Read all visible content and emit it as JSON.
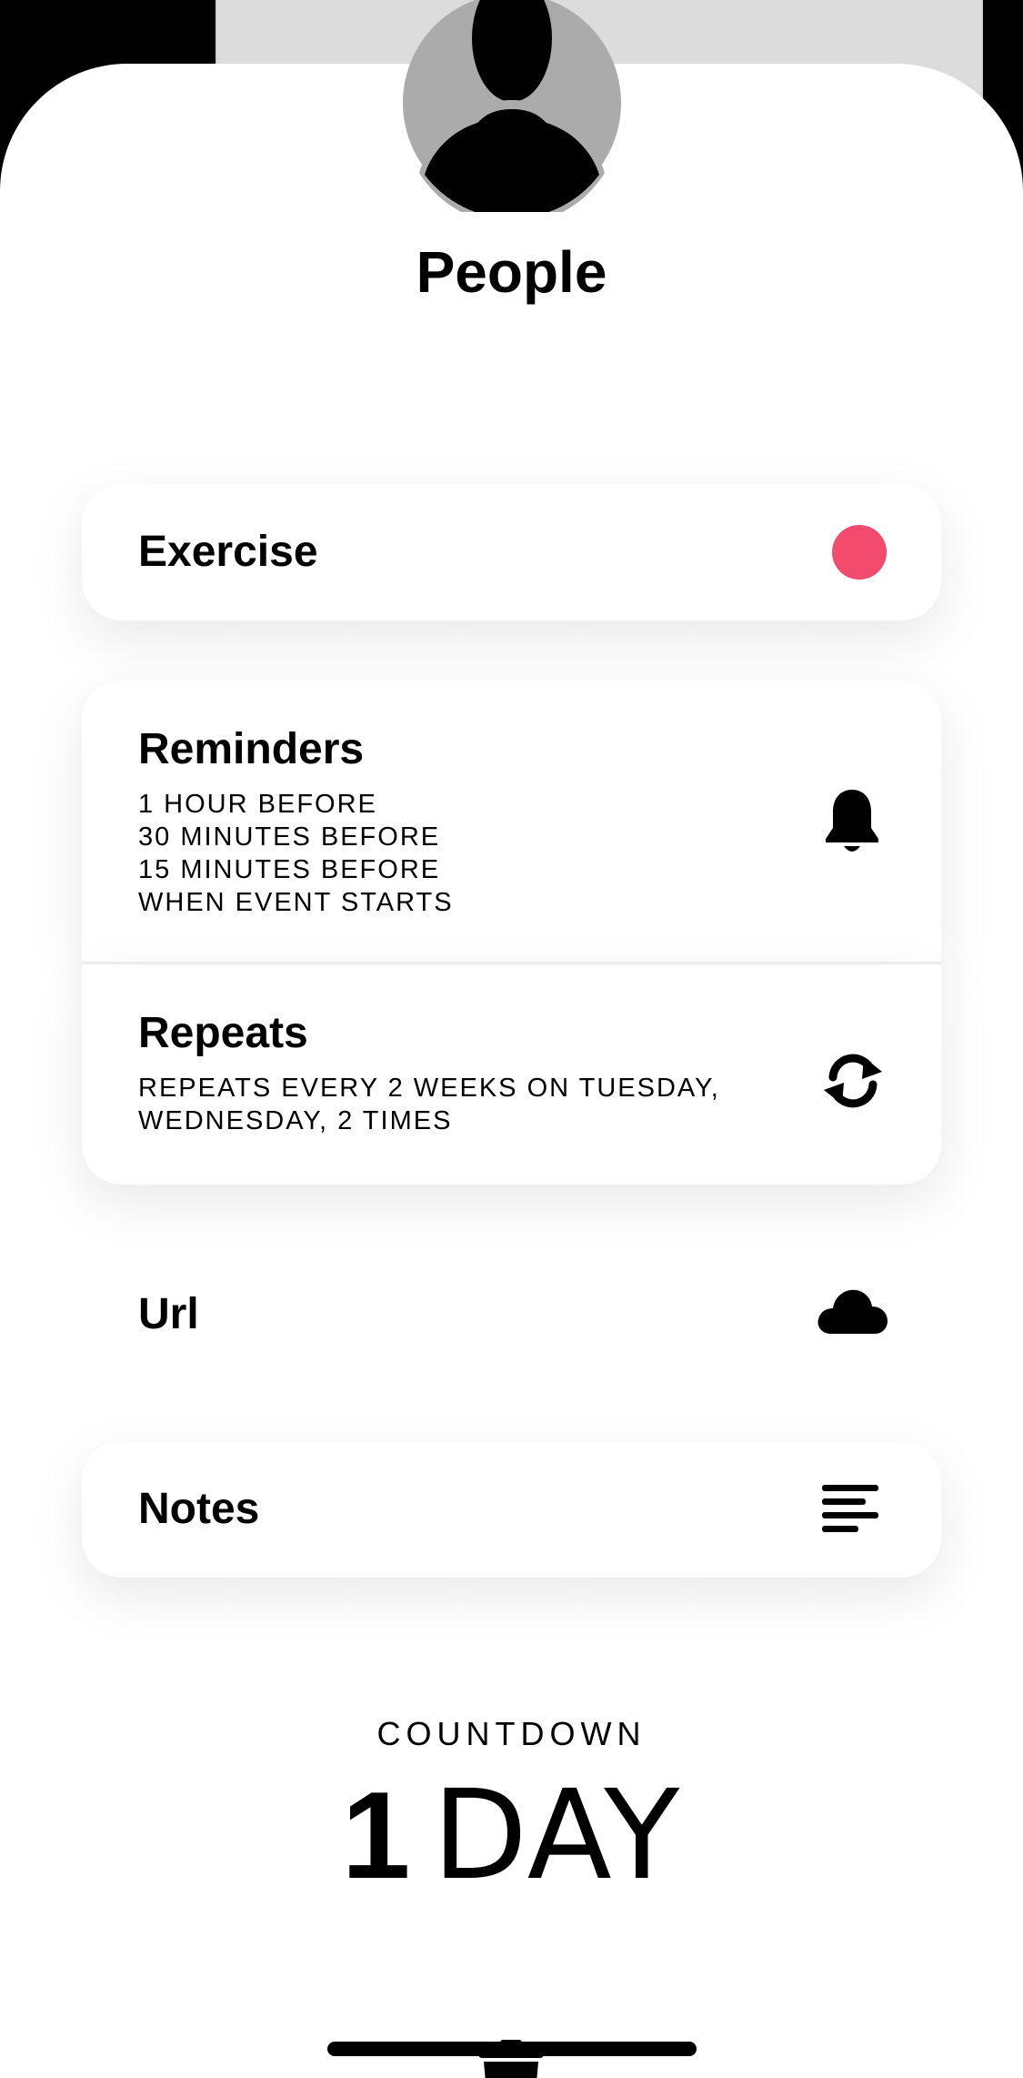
{
  "header": {
    "title": "People"
  },
  "exercise": {
    "label": "Exercise",
    "color": "#f24b6e"
  },
  "reminders": {
    "title": "Reminders",
    "items": [
      "1 HOUR BEFORE",
      "30 MINUTES BEFORE",
      "15 MINUTES BEFORE",
      "WHEN EVENT STARTS"
    ],
    "icon": "bell-icon"
  },
  "repeats": {
    "title": "Repeats",
    "lines": [
      "REPEATS EVERY 2 WEEKS ON TUESDAY,",
      "WEDNESDAY, 2 TIMES"
    ],
    "icon": "repeat-icon"
  },
  "url": {
    "label": "Url",
    "icon": "cloud-icon"
  },
  "notes": {
    "label": "Notes",
    "icon": "notes-icon"
  },
  "countdown": {
    "label": "COUNTDOWN",
    "value": "1",
    "unit": "DAY"
  },
  "footer": {
    "delete_icon": "trash-icon"
  },
  "colors": {
    "accent": "#f24b6e",
    "text": "#000000",
    "background": "#ffffff"
  }
}
